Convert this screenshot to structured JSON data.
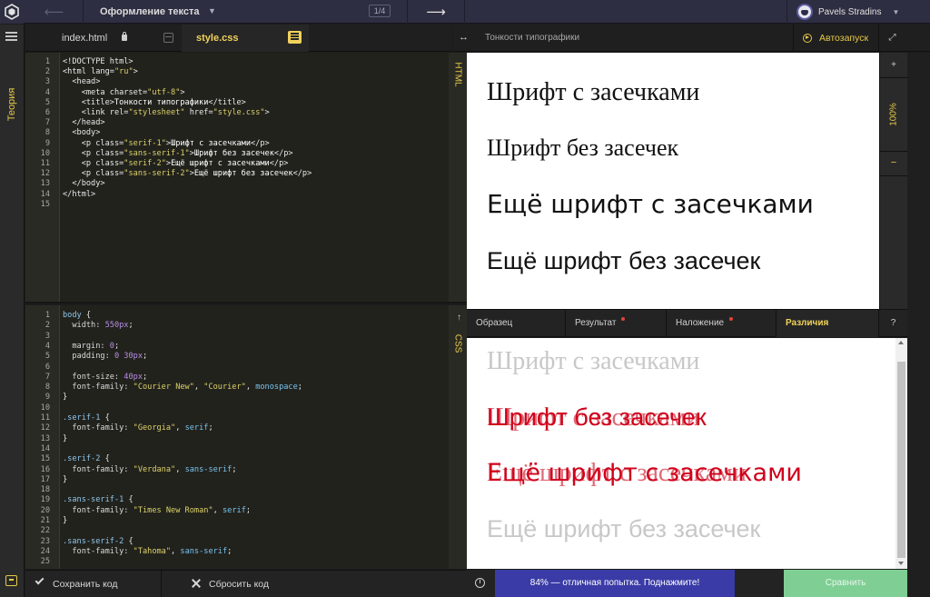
{
  "topbar": {
    "topic": "Оформление текста",
    "page_counter": "1/4",
    "user_name": "Pavels Stradins"
  },
  "rail": {
    "theory_label": "Теория"
  },
  "file_tabs": {
    "index": "index.html",
    "style": "style.css"
  },
  "html_editor": {
    "lang_label": "HTML",
    "line_numbers": [
      "1",
      "2",
      "3",
      "4",
      "5",
      "6",
      "7",
      "8",
      "9",
      "10",
      "11",
      "12",
      "13",
      "14",
      "15"
    ]
  },
  "css_editor": {
    "lang_label": "CSS",
    "line_numbers": [
      "1",
      "2",
      "3",
      "4",
      "5",
      "6",
      "7",
      "8",
      "9",
      "10",
      "11",
      "12",
      "13",
      "14",
      "15",
      "16",
      "17",
      "18",
      "19",
      "20",
      "21",
      "22",
      "23",
      "24",
      "25"
    ]
  },
  "bottom_bar": {
    "save_label": "Сохранить код",
    "reset_label": "Сбросить код"
  },
  "preview": {
    "title": "Тонкости типографики",
    "autostart_label": "Автозапуск",
    "zoom_level": "100%",
    "zoom_plus": "+",
    "zoom_minus": "−",
    "lines": [
      "Шрифт с засечками",
      "Шрифт без засечек",
      "Ещё шрифт с засечками",
      "Ещё шрифт без засечек"
    ]
  },
  "compare_tabs": {
    "sample": "Образец",
    "result": "Результат",
    "overlay": "Наложение",
    "diff": "Различия",
    "help": "?"
  },
  "diff": {
    "lines": [
      "Шрифт с засечками",
      "Шрифт без засечек",
      "Ещё шрифт с засечками",
      "Ещё шрифт без засечек"
    ]
  },
  "result_bar": {
    "score_text": "84% — отличная попытка. Поднажмите!",
    "compare_label": "Сравнить",
    "info_glyph": "i"
  },
  "colors": {
    "accent": "#e6c94a",
    "topbar_bg": "#2d2e41",
    "score_bg": "#3a3ba6",
    "compare_bg": "#7fcf94",
    "diff_red": "#d0021b"
  },
  "icons": [
    "logo-icon",
    "back-arrow-icon",
    "next-arrow-icon",
    "menu-icon",
    "chat-icon",
    "lock-icon",
    "panel-toggle-icon",
    "resize-icon",
    "play-icon",
    "expand-icon",
    "check-icon",
    "x-icon",
    "info-icon",
    "avatar"
  ]
}
